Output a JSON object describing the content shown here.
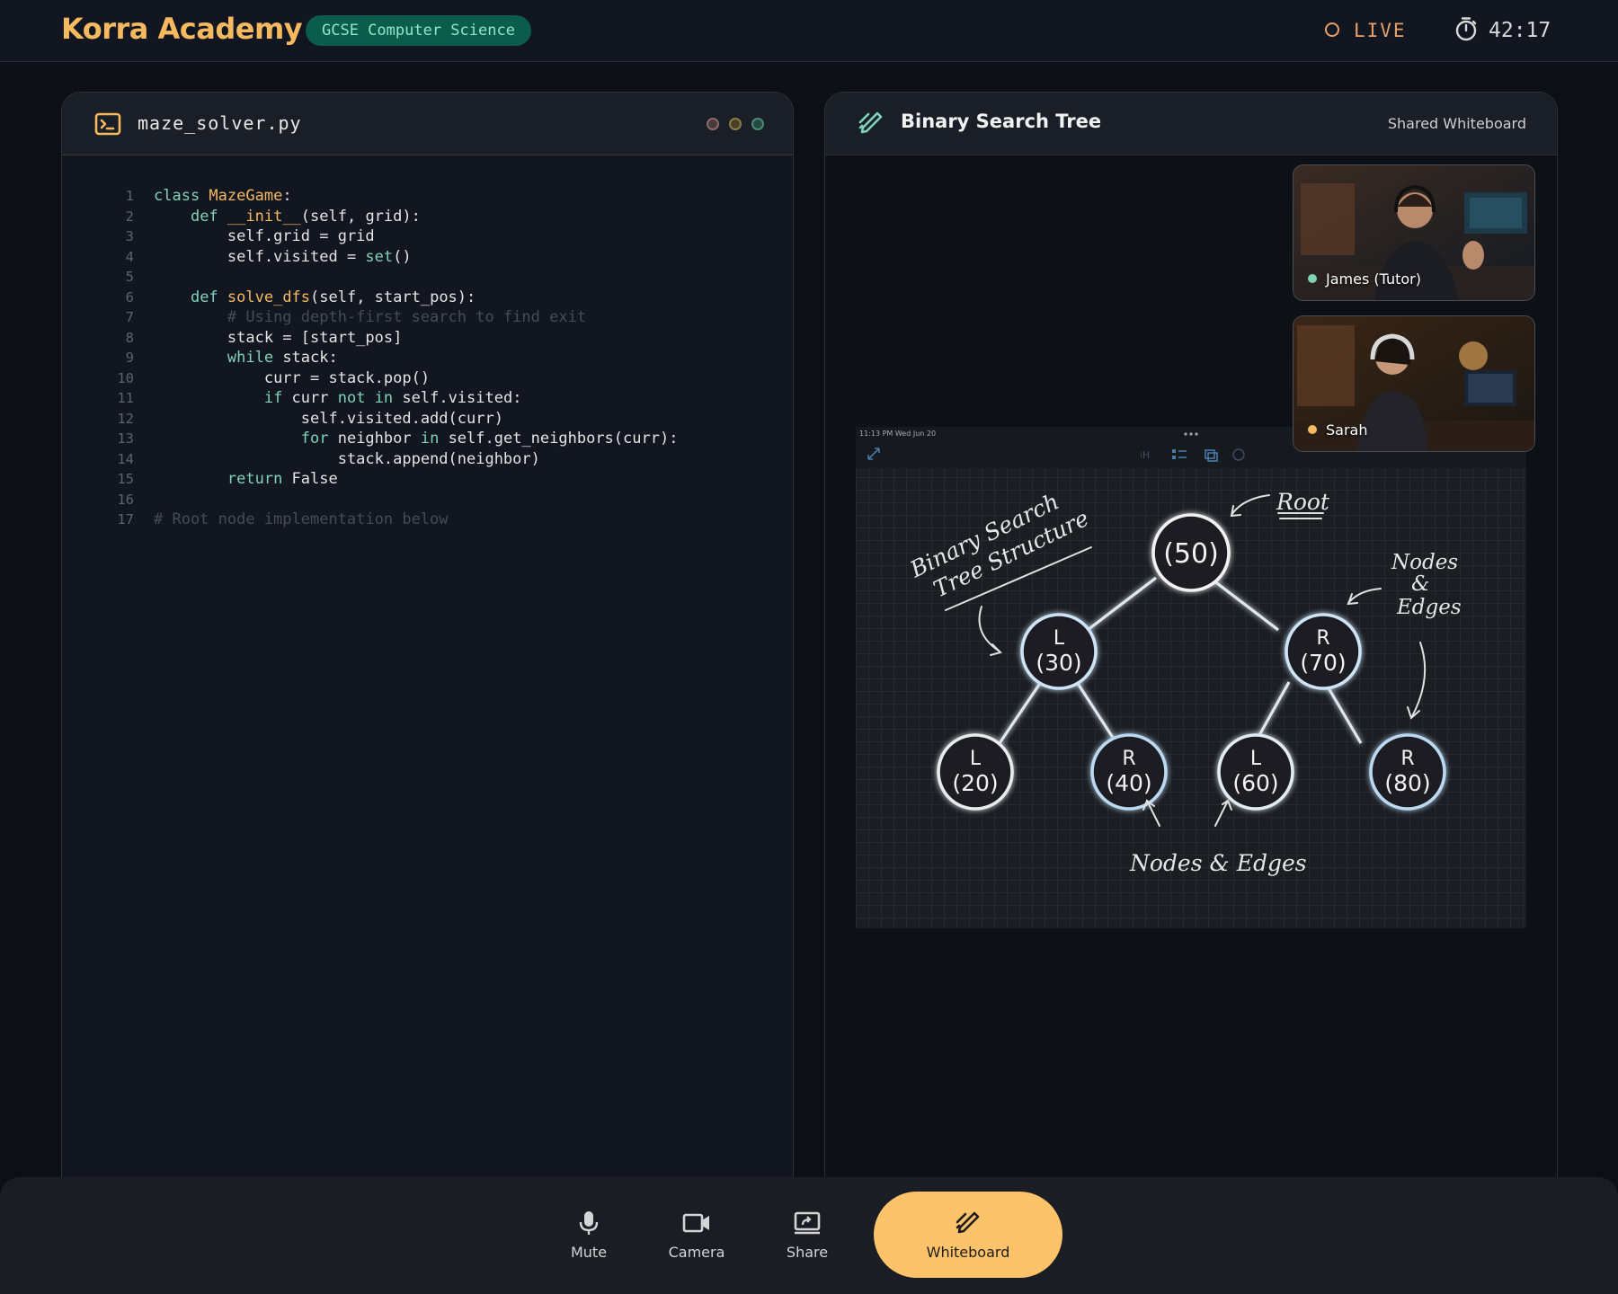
{
  "header": {
    "brand": "Korra Academy",
    "course": "GCSE Computer Science",
    "live_label": "LIVE",
    "timer": "42:17"
  },
  "editor": {
    "file_name": "maze_solver.py",
    "lines": [
      {
        "n": "1"
      },
      {
        "n": "2"
      },
      {
        "n": "3"
      },
      {
        "n": "4"
      },
      {
        "n": "5"
      },
      {
        "n": "6"
      },
      {
        "n": "7"
      },
      {
        "n": "8"
      },
      {
        "n": "9"
      },
      {
        "n": "10"
      },
      {
        "n": "11"
      },
      {
        "n": "12"
      },
      {
        "n": "13"
      },
      {
        "n": "14"
      },
      {
        "n": "15"
      },
      {
        "n": "16"
      },
      {
        "n": "17"
      }
    ],
    "code": {
      "l1_kw": "class ",
      "l1_name": "MazeGame",
      "l1_rest": ":",
      "l2_kw": "def ",
      "l2_name": "__init__",
      "l2_rest": "(self, grid):",
      "l3": "self.grid = grid",
      "l4_a": "self.visited = ",
      "l4_b": "set",
      "l4_c": "()",
      "l6_kw": "def ",
      "l6_name": "solve_dfs",
      "l6_rest": "(self, start_pos):",
      "l7": "# Using depth-first search to find exit",
      "l8": "stack = [start_pos]",
      "l9_kw": "while",
      "l9_rest": " stack:",
      "l10": "curr = stack.pop()",
      "l11_kw": "if",
      "l11_a": " curr ",
      "l11_kw2": "not in",
      "l11_b": " self.visited:",
      "l12": "self.visited.add(curr)",
      "l13_kw": "for",
      "l13_a": " neighbor ",
      "l13_kw2": "in",
      "l13_b": " self.get_neighbors(curr):",
      "l14": "stack.append(neighbor)",
      "l15_kw": "return",
      "l15_rest": " False",
      "l17": "# Root node implementation below"
    },
    "window_dot_colors": [
      "#7a5c5c",
      "#7a6a3c",
      "#3c6a5c"
    ]
  },
  "whiteboard": {
    "title": "Binary Search Tree",
    "shared_label": "Shared Whiteboard",
    "status_time": "11:13 PM   Wed Jun 20",
    "annotations": {
      "title_line1": "Binary Search",
      "title_line2": "Tree Structure",
      "root": "Root",
      "nodes_edges_side_1": "Nodes",
      "nodes_edges_side_2": "&",
      "nodes_edges_side_3": "Edges",
      "nodes_edges_bottom": "Nodes & Edges"
    },
    "nodes": {
      "root": "(50)",
      "l30_side": "L",
      "l30_val": "(30)",
      "r70_side": "R",
      "r70_val": "(70)",
      "l20_side": "L",
      "l20_val": "(20)",
      "r40_side": "R",
      "r40_val": "(40)",
      "l60_side": "L",
      "l60_val": "(60)",
      "r80_side": "R",
      "r80_val": "(80)"
    }
  },
  "participants": [
    {
      "name": "James (Tutor)",
      "status_color": "#7fd3b8"
    },
    {
      "name": "Sarah",
      "status_color": "#f5b95f"
    }
  ],
  "controls": {
    "mute": "Mute",
    "camera": "Camera",
    "share": "Share",
    "whiteboard": "Whiteboard"
  },
  "colors": {
    "accent": "#f5b95f",
    "teal": "#7fd3b8",
    "background": "#0c0f15"
  }
}
